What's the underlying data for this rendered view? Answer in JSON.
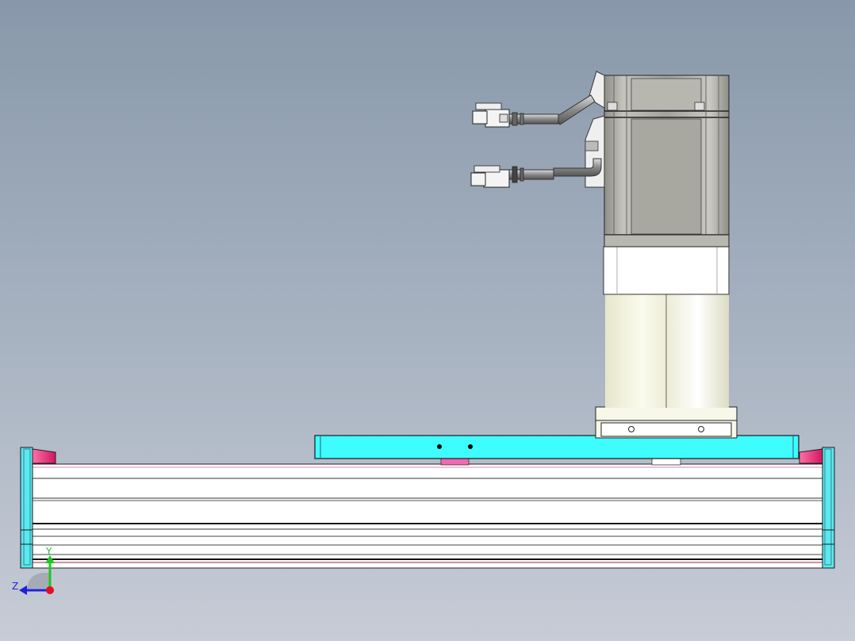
{
  "viewport": {
    "background_top": "#8898aa",
    "background_bottom": "#c7ccd6"
  },
  "axes": {
    "y_label": "Y",
    "z_label": "Z",
    "y_color": "#1ec81e",
    "z_color": "#2020d8",
    "origin_color": "#e01020"
  },
  "colors": {
    "carriage": "#3ffcff",
    "end_cap": "#5ce8f0",
    "accent_pink": "#f0307a",
    "motor_body": "#a8a8a0",
    "reducer": "#f5f5e6",
    "rail": "#ffffff"
  }
}
